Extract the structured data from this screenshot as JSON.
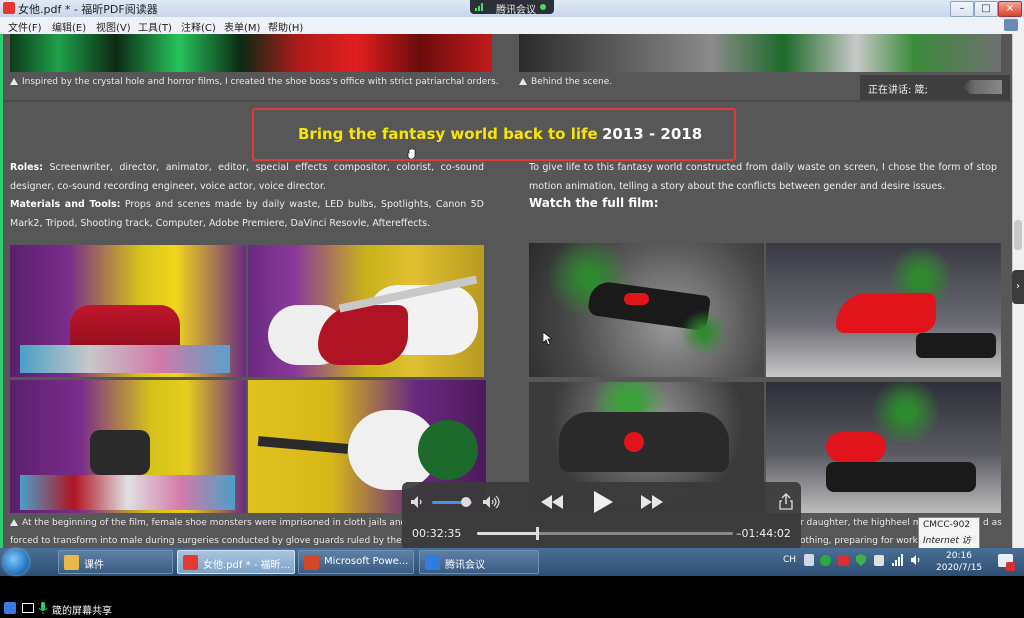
{
  "window": {
    "title": "女他.pdf * - 福昕PDF阅读器",
    "controls": [
      "–",
      "□",
      "×"
    ],
    "mini_controls": [
      "–",
      "□",
      "×"
    ]
  },
  "meeting_bar": {
    "label": "腾讯会议"
  },
  "menu": {
    "items": [
      "文件(F)",
      "编辑(E)",
      "视图(V)",
      "工具(T)",
      "注释(C)",
      "表单(M)",
      "帮助(H)"
    ]
  },
  "speaking": {
    "label": "正在讲话: 箴;"
  },
  "document": {
    "top_caption_left": "Inspired by the crystal hole and horror films, I created the shoe boss's office with strict patriarchal orders.",
    "top_caption_right": "Behind the scene.",
    "title": "Bring the fantasy world back to life",
    "years": "2013 - 2018",
    "roles_label": "Roles:",
    "roles_text": "Screenwriter, director, animator, editor, special effects compositor, colorist, co-sound designer, co-sound recording engineer, voice actor, voice director.",
    "materials_label": "Materials and Tools:",
    "materials_text": "Props and scenes made by daily waste, LED bulbs, Spotlights, Canon 5D Mark2, Tripod, Shooting track, Computer, Adobe Premiere, DaVinci Resovle, Aftereffects.",
    "right_text": "To give life to this fantasy world constructed from daily waste on screen, I chose the form of stop motion animation, telling a story about the conflicts between gender and desire issues.",
    "watch_label": "Watch the full film:",
    "bottom_caption_left_1": "At the beginning of the film, female shoe monsters were imprisoned in cloth jails and",
    "bottom_caption_left_2": "forced to transform into male during surgeries conducted by glove guards ruled by the m",
    "bottom_caption_right_1": "r daughter, the highheel m",
    "bottom_caption_right_1b": "d as",
    "bottom_caption_right_2": "othing, preparing for work."
  },
  "player": {
    "elapsed": "00:32:35",
    "remaining": "–01:44:02",
    "progress": 0.24,
    "volume": 0.85
  },
  "tooltip": {
    "line1": "CMCC-902",
    "line2": "Internet 访问"
  },
  "taskbar": {
    "tasks": [
      {
        "label": "课件",
        "color": "#e8b84a"
      },
      {
        "label": "女他.pdf * - 福昕...",
        "color": "#e53935"
      },
      {
        "label": "Microsoft Powe...",
        "color": "#d24726"
      },
      {
        "label": "腾讯会议",
        "color": "#2f7de1"
      }
    ],
    "lang": "CH",
    "time": "20:16",
    "date": "2020/7/15"
  },
  "share_bar": {
    "label": "箴的屏幕共享"
  }
}
